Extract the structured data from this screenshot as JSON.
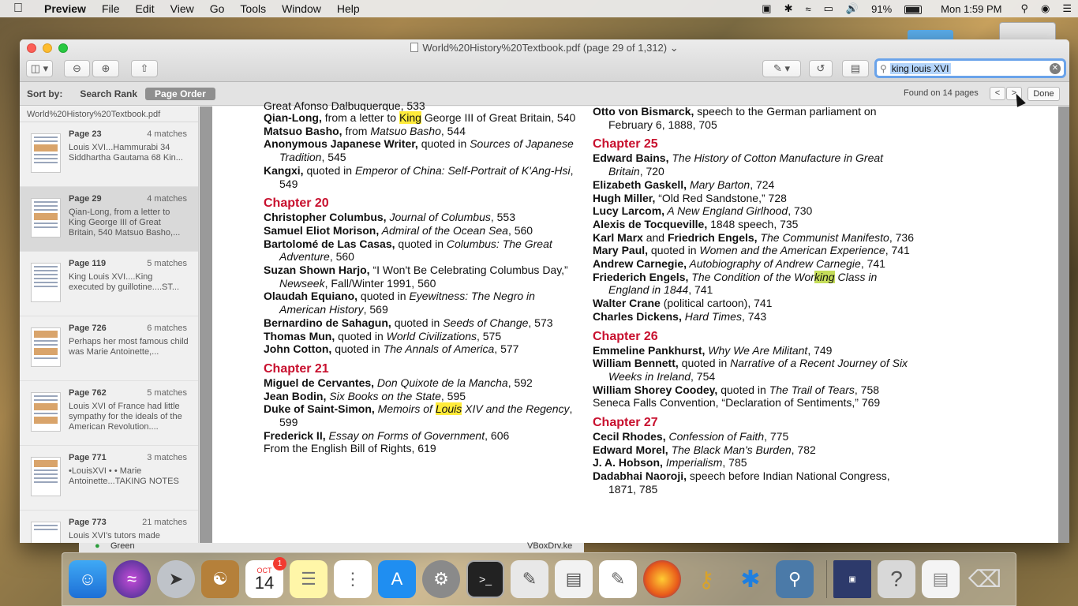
{
  "menubar": {
    "app": "Preview",
    "items": [
      "File",
      "Edit",
      "View",
      "Go",
      "Tools",
      "Window",
      "Help"
    ],
    "battery": "91%",
    "clock": "Mon 1:59 PM"
  },
  "window": {
    "title": "World%20History%20Textbook.pdf (page 29 of 1,312)",
    "search_value": "king louis XVI"
  },
  "sortbar": {
    "label": "Sort by:",
    "option_rank": "Search Rank",
    "option_order": "Page Order",
    "found": "Found on 14 pages",
    "prev": "<",
    "next": ">",
    "done": "Done"
  },
  "sidebar": {
    "filename": "World%20History%20Textbook.pdf",
    "results": [
      {
        "page": "Page 23",
        "matches": "4 matches",
        "text": "Louis XVI...Hammurabi 34 Siddhartha Gautama 68 Kin..."
      },
      {
        "page": "Page 29",
        "matches": "4 matches",
        "text": "Qian-Long, from a letter to King George III of Great Britain, 540 Matsuo Basho,..."
      },
      {
        "page": "Page 119",
        "matches": "5 matches",
        "text": "King Louis XVI....King executed by guillotine....ST..."
      },
      {
        "page": "Page 726",
        "matches": "6 matches",
        "text": "Perhaps her most famous child was Marie Antoinette,..."
      },
      {
        "page": "Page 762",
        "matches": "5 matches",
        "text": "Louis XVI of France had little sympathy for the ideals of the American Revolution...."
      },
      {
        "page": "Page 771",
        "matches": "3 matches",
        "text": "•LouisXVI • • Marie Antoinette...TAKING NOTES"
      },
      {
        "page": "Page 773",
        "matches": "21 matches",
        "text": "Louis XVI's tutors made"
      }
    ]
  },
  "doc": {
    "col1_top": "Great Afonso Dalbuquerque, 533",
    "qian_b": "Qian-Long,",
    "qian_t1": " from a letter to ",
    "qian_hl": "King",
    "qian_t2": " George III of Great Britain, 540",
    "basho_b": "Matsuo Basho,",
    "basho_t": " from ",
    "basho_i": "Matsuo Basho",
    "basho_n": ", 544",
    "anon_b": "Anonymous Japanese Writer,",
    "anon_t": " quoted in ",
    "anon_i": "Sources of Japanese Tradition",
    "anon_n": ", 545",
    "kangxi_b": "Kangxi,",
    "kangxi_t": " quoted in ",
    "kangxi_i": "Emperor of China: Self-Portrait of K'Ang-Hsi",
    "kangxi_n": ", 549",
    "ch20": "Chapter 20",
    "colum_b": "Christopher Columbus,",
    "colum_i": " Journal of Columbus",
    "colum_n": ", 553",
    "morison_b": "Samuel Eliot Morison,",
    "morison_i": " Admiral of the Ocean Sea",
    "morison_n": ", 560",
    "casas_b": "Bartolomé de Las Casas,",
    "casas_t": " quoted in ",
    "casas_i": "Columbus: The Great Adventure",
    "casas_n": ", 560",
    "harjo_b": "Suzan Shown Harjo,",
    "harjo_t": " “I Won't Be Celebrating Columbus Day,” ",
    "harjo_i": "Newseek",
    "harjo_n": ", Fall/Winter 1991, 560",
    "equiano_b": "Olaudah Equiano,",
    "equiano_t": " quoted in ",
    "equiano_i": "Eyewitness: The Negro in American History",
    "equiano_n": ", 569",
    "sahagun_b": "Bernardino de Sahagun,",
    "sahagun_t": " quoted in ",
    "sahagun_i": "Seeds of Change",
    "sahagun_n": ", 573",
    "mun_b": "Thomas Mun,",
    "mun_t": " quoted in ",
    "mun_i": "World Civilizations",
    "mun_n": ", 575",
    "cotton_b": "John Cotton,",
    "cotton_t": " quoted in ",
    "cotton_i": "The Annals of America",
    "cotton_n": ", 577",
    "ch21": "Chapter 21",
    "cerv_b": "Miguel de Cervantes,",
    "cerv_i": " Don Quixote de la Mancha",
    "cerv_n": ", 592",
    "bodin_b": "Jean Bodin,",
    "bodin_i": " Six Books on the State",
    "bodin_n": ", 595",
    "simon_b": "Duke of Saint-Simon,",
    "simon_i1": " Memoirs of ",
    "simon_hl": "Louis",
    "simon_i2": " XIV and the Regency",
    "simon_n": ", 599",
    "fred_b": "Frederick II,",
    "fred_i": " Essay on Forms of Government",
    "fred_n": ", 606",
    "bill": "From the English Bill of Rights, 619",
    "bis_b": "Otto von Bismarck,",
    "bis_t": " speech to the German parliament on February 6, 1888, 705",
    "ch25": "Chapter 25",
    "baines_b": "Edward Bains,",
    "baines_i": " The History of Cotton Manufacture in Great Britain",
    "baines_n": ", 720",
    "gaskell_b": "Elizabeth Gaskell,",
    "gaskell_i": " Mary Barton",
    "gaskell_n": ", 724",
    "miller_b": "Hugh Miller,",
    "miller_t": " “Old Red Sandstone,” 728",
    "larcom_b": "Lucy Larcom,",
    "larcom_i": " A New England Girlhood",
    "larcom_n": ", 730",
    "tocq_b": "Alexis de Tocqueville,",
    "tocq_t": " 1848 speech, 735",
    "marx_b1": "Karl Marx",
    "marx_t": " and ",
    "marx_b2": "Friedrich Engels,",
    "marx_i": " The Communist Manifesto",
    "marx_n": ", 736",
    "paul_b": "Mary Paul,",
    "paul_t": " quoted in ",
    "paul_i": "Women and the American Experience",
    "paul_n": ", 741",
    "carn_b": "Andrew Carnegie,",
    "carn_i": " Autobiography of Andrew Carnegie",
    "carn_n": ", 741",
    "eng_b": "Friederich Engels,",
    "eng_i1": " The Condition of the Wor",
    "eng_hl": "king",
    "eng_i2": " Class in England in 1844",
    "eng_n": ", 741",
    "crane_b": "Walter Crane",
    "crane_t": " (political cartoon), 741",
    "dick_b": "Charles Dickens,",
    "dick_i": " Hard Times",
    "dick_n": ", 743",
    "ch26": "Chapter 26",
    "pank_b": "Emmeline Pankhurst,",
    "pank_i": " Why We Are Militant",
    "pank_n": ", 749",
    "benn_b": "William Bennett,",
    "benn_t": " quoted in ",
    "benn_i": "Narrative of a Recent Journey of Six Weeks in Ireland",
    "benn_n": ", 754",
    "coodey_b": "William Shorey Coodey,",
    "coodey_t": " quoted in ",
    "coodey_i": "The Trail of Tears",
    "coodey_n": ", 758",
    "seneca": "Seneca Falls Convention, “Declaration of Sentiments,” 769",
    "ch27": "Chapter 27",
    "rhodes_b": "Cecil Rhodes,",
    "rhodes_i": " Confession of Faith",
    "rhodes_n": ", 775",
    "morel_b": "Edward Morel,",
    "morel_i": " The Black Man's Burden",
    "morel_n": ", 782",
    "hobson_b": "J. A. Hobson,",
    "hobson_i": " Imperialism",
    "hobson_n": ", 785",
    "naoroji_b": "Dadabhai Naoroji,",
    "naoroji_t": " speech before Indian National Congress, 1871, 785"
  },
  "background": {
    "strip_left": "Green",
    "strip_right": "VBoxDrv.ke"
  },
  "dock": {
    "calendar_month": "OCT",
    "calendar_day": "14",
    "calendar_badge": "1"
  }
}
